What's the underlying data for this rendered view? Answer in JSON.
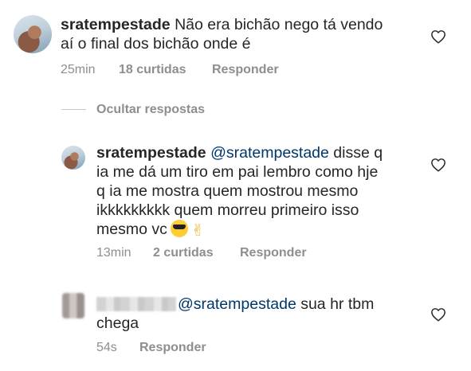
{
  "comments": [
    {
      "username": "sratempestade",
      "text_line1": "Não era bichão nego tá vendo",
      "text_line2": "aí o final dos bichão onde é",
      "time": "25min",
      "likes": "18 curtidas",
      "reply": "Responder"
    }
  ],
  "hide_replies": "Ocultar respostas",
  "replies": [
    {
      "username": "sratempestade",
      "mention": "@sratempestade",
      "text_l1": " disse q",
      "text_l2": "ia me dá um tiro em pai lembro como hje",
      "text_l3": "q ia me mostra quem mostrou mesmo",
      "text_l4": "ikkkkkkkkk quem morreu primeiro isso",
      "text_l5": "mesmo vc",
      "time": "13min",
      "likes": "2 curtidas",
      "reply": "Responder"
    },
    {
      "mention": "@sratempestade",
      "text_l1": " sua hr tbm",
      "text_l2": "chega",
      "time": "54s",
      "reply": "Responder"
    }
  ],
  "icons": {
    "like": "heart-outline-icon",
    "emoji1": "sunglasses-face-emoji",
    "emoji2": "victory-hand-emoji"
  }
}
